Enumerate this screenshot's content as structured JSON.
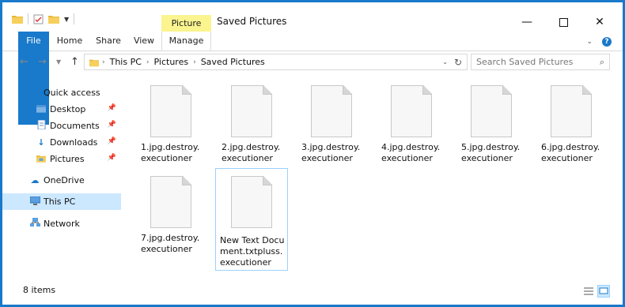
{
  "window": {
    "title": "Saved Pictures",
    "contextual_tab_group": "Picture Tools"
  },
  "ribbon": {
    "tabs": [
      "File",
      "Home",
      "Share",
      "View",
      "Manage"
    ]
  },
  "address": {
    "breadcrumbs": [
      "This PC",
      "Pictures",
      "Saved Pictures"
    ],
    "search_placeholder": "Search Saved Pictures"
  },
  "nav_pane": {
    "items": [
      {
        "label": "Quick access",
        "icon": "star-icon"
      },
      {
        "label": "Desktop",
        "icon": "folder-icon",
        "pinned": true
      },
      {
        "label": "Documents",
        "icon": "documents-icon",
        "pinned": true
      },
      {
        "label": "Downloads",
        "icon": "downloads-icon",
        "pinned": true
      },
      {
        "label": "Pictures",
        "icon": "pictures-icon",
        "pinned": true
      },
      {
        "label": "OneDrive",
        "icon": "cloud-icon"
      },
      {
        "label": "This PC",
        "icon": "computer-icon",
        "selected": true
      },
      {
        "label": "Network",
        "icon": "network-icon"
      }
    ]
  },
  "files": [
    {
      "name": "1.jpg.destroy.executioner"
    },
    {
      "name": "2.jpg.destroy.executioner"
    },
    {
      "name": "3.jpg.destroy.executioner"
    },
    {
      "name": "4.jpg.destroy.executioner"
    },
    {
      "name": "5.jpg.destroy.executioner"
    },
    {
      "name": "6.jpg.destroy.executioner"
    },
    {
      "name": "7.jpg.destroy.executioner"
    },
    {
      "name": "New Text Document.txtpluss.executioner"
    }
  ],
  "status": {
    "item_count": "8 items"
  },
  "colors": {
    "accent": "#1979ca",
    "picture_tools": "#fbf48f",
    "selection": "#cce8ff"
  }
}
